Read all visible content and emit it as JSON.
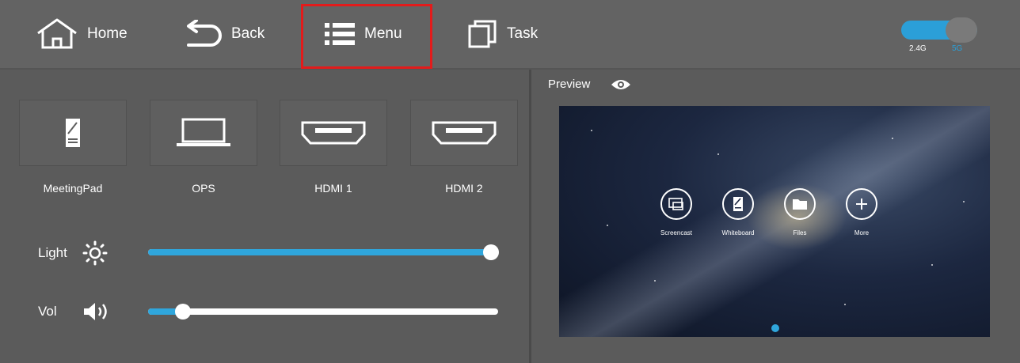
{
  "topbar": {
    "home_label": "Home",
    "back_label": "Back",
    "menu_label": "Menu",
    "task_label": "Task",
    "band": {
      "option_a": "2.4G",
      "option_b": "5G",
      "accent": "#2b9fd8"
    }
  },
  "sources": [
    {
      "label": "MeetingPad",
      "icon": "tablet-icon"
    },
    {
      "label": "OPS",
      "icon": "laptop-icon"
    },
    {
      "label": "HDMI 1",
      "icon": "hdmi-port-icon"
    },
    {
      "label": "HDMI 2",
      "icon": "hdmi-port-icon"
    }
  ],
  "controls": {
    "light": {
      "label": "Light",
      "icon": "brightness-icon",
      "value_percent": 98
    },
    "vol": {
      "label": "Vol",
      "icon": "speaker-icon",
      "value_percent": 10
    },
    "accent": "#2fa6dc"
  },
  "preview": {
    "label": "Preview",
    "icon": "eye-icon",
    "apps": [
      {
        "label": "Screencast",
        "icon": "screencast-icon"
      },
      {
        "label": "Whiteboard",
        "icon": "whiteboard-icon"
      },
      {
        "label": "Files",
        "icon": "folder-icon"
      },
      {
        "label": "More",
        "icon": "plus-icon"
      }
    ]
  },
  "highlight_color": "#e31b1b"
}
